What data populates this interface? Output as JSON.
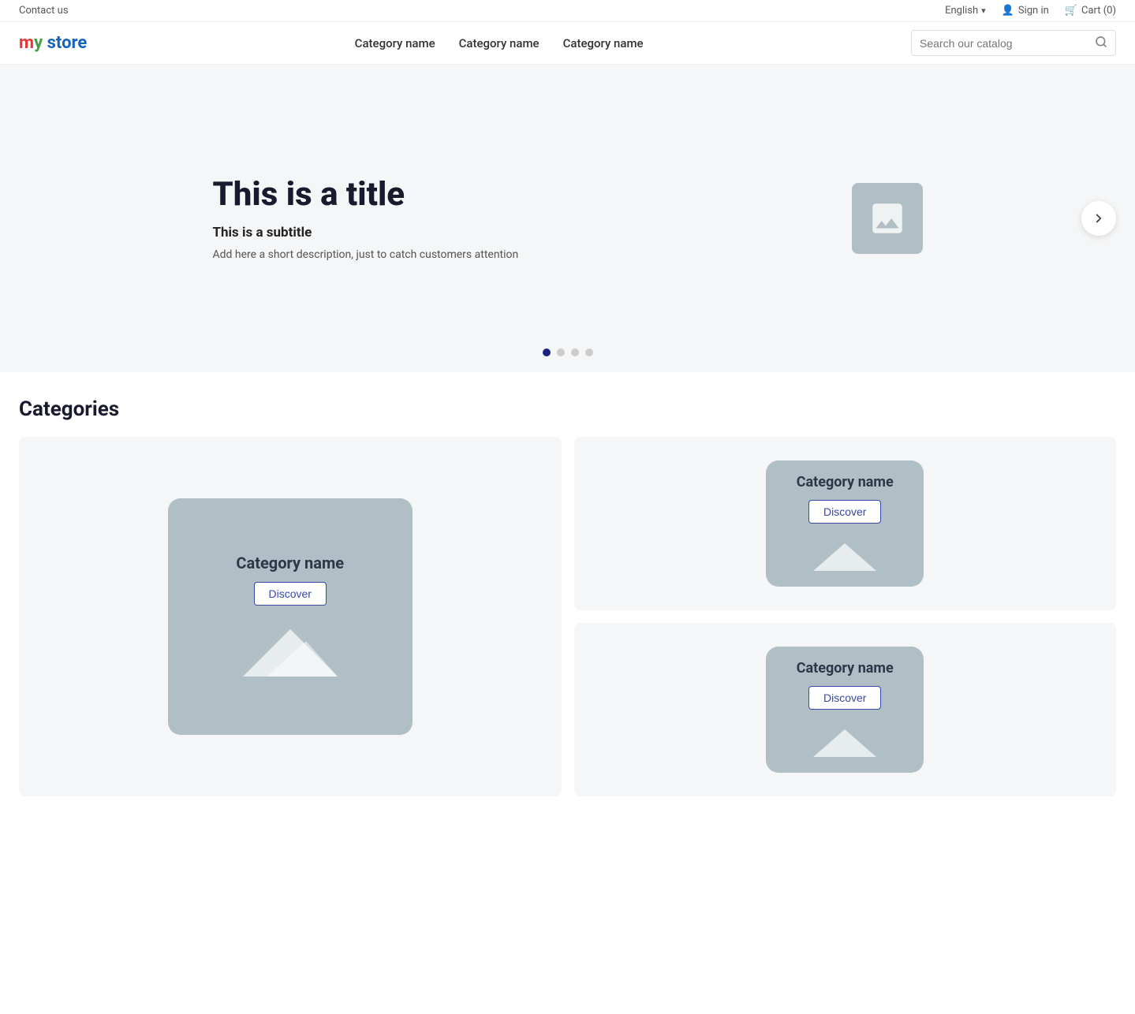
{
  "topbar": {
    "contact_label": "Contact us",
    "language": "English",
    "sign_in_label": "Sign in",
    "cart_label": "Cart (0)"
  },
  "header": {
    "logo": {
      "text": "my store",
      "my_text": "my",
      "store_text": "store"
    },
    "nav_items": [
      {
        "label": "Category name"
      },
      {
        "label": "Category name"
      },
      {
        "label": "Category name"
      }
    ],
    "search_placeholder": "Search our catalog"
  },
  "hero": {
    "title": "This is a title",
    "subtitle": "This is a subtitle",
    "description": "Add here a short description, just to catch customers attention",
    "dots_count": 4
  },
  "categories": {
    "section_title": "Categories",
    "items": [
      {
        "name": "Category name",
        "discover_label": "Discover",
        "size": "large"
      },
      {
        "name": "Category name",
        "discover_label": "Discover",
        "size": "small"
      },
      {
        "name": "Category name",
        "discover_label": "Discover",
        "size": "small"
      }
    ]
  }
}
